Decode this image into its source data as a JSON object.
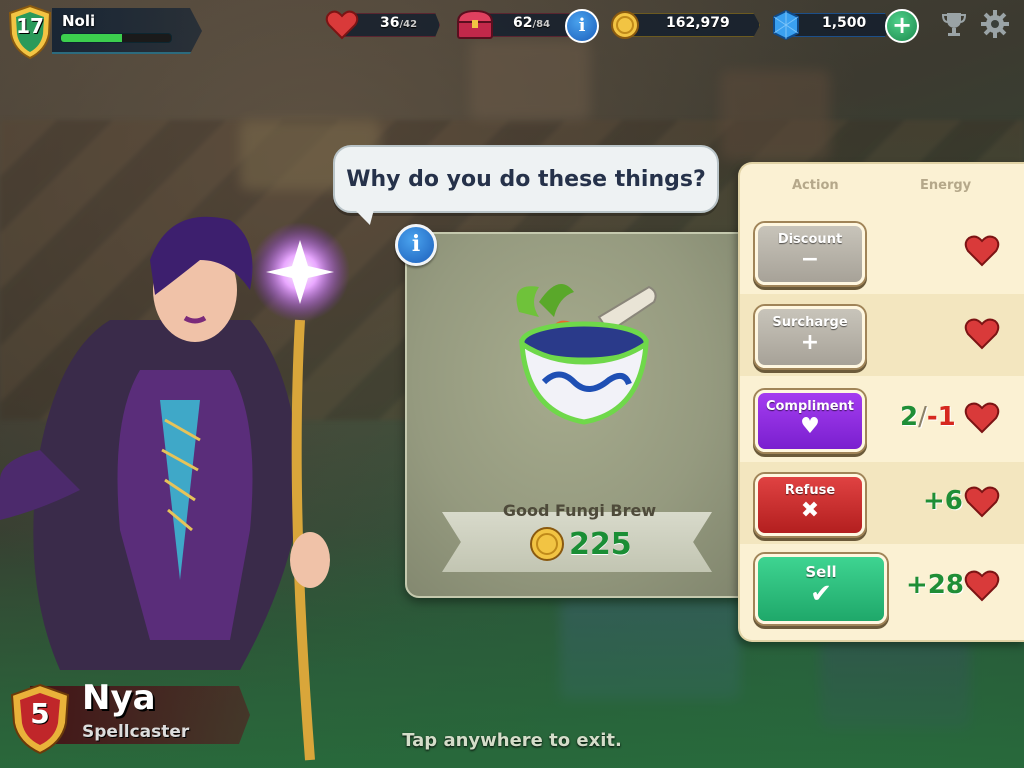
{
  "hud": {
    "player_level": "17",
    "player_name": "Noli",
    "xp_progress": 0.55,
    "energy_current": "36",
    "energy_max": "/42",
    "storage_current": "62",
    "storage_max": "/84",
    "coins": "162,979",
    "gems": "1,500",
    "icons": [
      "heart-icon",
      "chest-icon",
      "info-icon",
      "coin-icon",
      "gem-icon",
      "plus-icon",
      "trophy-icon",
      "gear-icon"
    ]
  },
  "dialog": {
    "speech": "Why do you do these things?"
  },
  "item": {
    "name": "Good Fungi Brew",
    "price": "225",
    "icon": "mortar-and-pestle-icon"
  },
  "actions": {
    "col_action": "Action",
    "col_energy": "Energy",
    "rows": [
      {
        "label": "Discount",
        "symbol": "−",
        "color": "#b8b3a8",
        "energy": ""
      },
      {
        "label": "Surcharge",
        "symbol": "+",
        "color": "#b8b3a8",
        "energy": ""
      },
      {
        "label": "Compliment",
        "symbol": "♥",
        "color": "#8e2de2",
        "energy_a": "2",
        "energy_sep": "/",
        "energy_b": "-1"
      },
      {
        "label": "Refuse",
        "symbol": "✖",
        "color": "#c92a2a",
        "energy": "+6"
      },
      {
        "label": "Sell",
        "symbol": "✔",
        "color": "#2bbd7e",
        "energy": "+28"
      }
    ]
  },
  "customer": {
    "level": "5",
    "name": "Nya",
    "class": "Spellcaster"
  },
  "footer": {
    "hint": "Tap anywhere to exit."
  },
  "colors": {
    "coin_green": "#1a8e35",
    "panel_bg": "#fbf1d3",
    "negative_red": "#d6281f"
  }
}
